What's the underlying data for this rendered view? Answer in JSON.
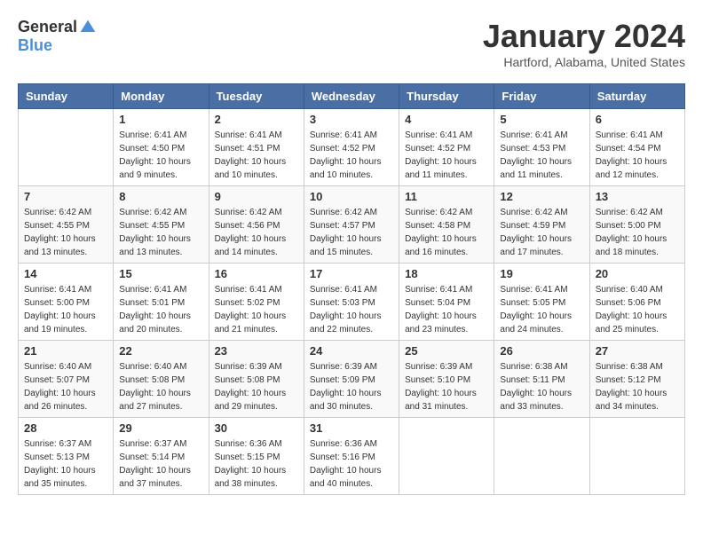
{
  "header": {
    "logo": {
      "general": "General",
      "blue": "Blue"
    },
    "title": "January 2024",
    "location": "Hartford, Alabama, United States"
  },
  "weekdays": [
    "Sunday",
    "Monday",
    "Tuesday",
    "Wednesday",
    "Thursday",
    "Friday",
    "Saturday"
  ],
  "weeks": [
    [
      {
        "day": null
      },
      {
        "day": "1",
        "sunrise": "6:41 AM",
        "sunset": "4:50 PM",
        "daylight": "10 hours and 9 minutes."
      },
      {
        "day": "2",
        "sunrise": "6:41 AM",
        "sunset": "4:51 PM",
        "daylight": "10 hours and 10 minutes."
      },
      {
        "day": "3",
        "sunrise": "6:41 AM",
        "sunset": "4:52 PM",
        "daylight": "10 hours and 10 minutes."
      },
      {
        "day": "4",
        "sunrise": "6:41 AM",
        "sunset": "4:52 PM",
        "daylight": "10 hours and 11 minutes."
      },
      {
        "day": "5",
        "sunrise": "6:41 AM",
        "sunset": "4:53 PM",
        "daylight": "10 hours and 11 minutes."
      },
      {
        "day": "6",
        "sunrise": "6:41 AM",
        "sunset": "4:54 PM",
        "daylight": "10 hours and 12 minutes."
      }
    ],
    [
      {
        "day": "7",
        "sunrise": "6:42 AM",
        "sunset": "4:55 PM",
        "daylight": "10 hours and 13 minutes."
      },
      {
        "day": "8",
        "sunrise": "6:42 AM",
        "sunset": "4:55 PM",
        "daylight": "10 hours and 13 minutes."
      },
      {
        "day": "9",
        "sunrise": "6:42 AM",
        "sunset": "4:56 PM",
        "daylight": "10 hours and 14 minutes."
      },
      {
        "day": "10",
        "sunrise": "6:42 AM",
        "sunset": "4:57 PM",
        "daylight": "10 hours and 15 minutes."
      },
      {
        "day": "11",
        "sunrise": "6:42 AM",
        "sunset": "4:58 PM",
        "daylight": "10 hours and 16 minutes."
      },
      {
        "day": "12",
        "sunrise": "6:42 AM",
        "sunset": "4:59 PM",
        "daylight": "10 hours and 17 minutes."
      },
      {
        "day": "13",
        "sunrise": "6:42 AM",
        "sunset": "5:00 PM",
        "daylight": "10 hours and 18 minutes."
      }
    ],
    [
      {
        "day": "14",
        "sunrise": "6:41 AM",
        "sunset": "5:00 PM",
        "daylight": "10 hours and 19 minutes."
      },
      {
        "day": "15",
        "sunrise": "6:41 AM",
        "sunset": "5:01 PM",
        "daylight": "10 hours and 20 minutes."
      },
      {
        "day": "16",
        "sunrise": "6:41 AM",
        "sunset": "5:02 PM",
        "daylight": "10 hours and 21 minutes."
      },
      {
        "day": "17",
        "sunrise": "6:41 AM",
        "sunset": "5:03 PM",
        "daylight": "10 hours and 22 minutes."
      },
      {
        "day": "18",
        "sunrise": "6:41 AM",
        "sunset": "5:04 PM",
        "daylight": "10 hours and 23 minutes."
      },
      {
        "day": "19",
        "sunrise": "6:41 AM",
        "sunset": "5:05 PM",
        "daylight": "10 hours and 24 minutes."
      },
      {
        "day": "20",
        "sunrise": "6:40 AM",
        "sunset": "5:06 PM",
        "daylight": "10 hours and 25 minutes."
      }
    ],
    [
      {
        "day": "21",
        "sunrise": "6:40 AM",
        "sunset": "5:07 PM",
        "daylight": "10 hours and 26 minutes."
      },
      {
        "day": "22",
        "sunrise": "6:40 AM",
        "sunset": "5:08 PM",
        "daylight": "10 hours and 27 minutes."
      },
      {
        "day": "23",
        "sunrise": "6:39 AM",
        "sunset": "5:08 PM",
        "daylight": "10 hours and 29 minutes."
      },
      {
        "day": "24",
        "sunrise": "6:39 AM",
        "sunset": "5:09 PM",
        "daylight": "10 hours and 30 minutes."
      },
      {
        "day": "25",
        "sunrise": "6:39 AM",
        "sunset": "5:10 PM",
        "daylight": "10 hours and 31 minutes."
      },
      {
        "day": "26",
        "sunrise": "6:38 AM",
        "sunset": "5:11 PM",
        "daylight": "10 hours and 33 minutes."
      },
      {
        "day": "27",
        "sunrise": "6:38 AM",
        "sunset": "5:12 PM",
        "daylight": "10 hours and 34 minutes."
      }
    ],
    [
      {
        "day": "28",
        "sunrise": "6:37 AM",
        "sunset": "5:13 PM",
        "daylight": "10 hours and 35 minutes."
      },
      {
        "day": "29",
        "sunrise": "6:37 AM",
        "sunset": "5:14 PM",
        "daylight": "10 hours and 37 minutes."
      },
      {
        "day": "30",
        "sunrise": "6:36 AM",
        "sunset": "5:15 PM",
        "daylight": "10 hours and 38 minutes."
      },
      {
        "day": "31",
        "sunrise": "6:36 AM",
        "sunset": "5:16 PM",
        "daylight": "10 hours and 40 minutes."
      },
      {
        "day": null
      },
      {
        "day": null
      },
      {
        "day": null
      }
    ]
  ],
  "labels": {
    "sunrise": "Sunrise:",
    "sunset": "Sunset:",
    "daylight": "Daylight:"
  }
}
